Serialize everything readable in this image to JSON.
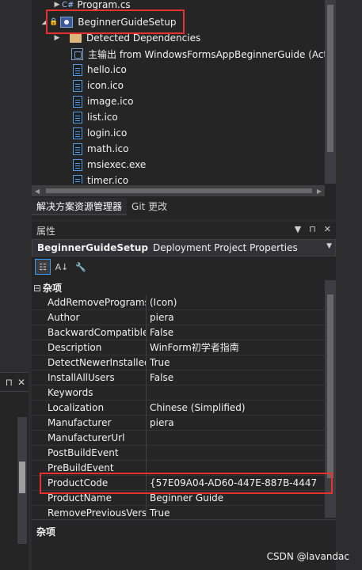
{
  "solution_explorer": {
    "partial_item": "Program.cs",
    "project": "BeginnerGuideSetup",
    "items": [
      {
        "label": "Detected Dependencies",
        "icon": "folder-icon"
      },
      {
        "label": "主输出 from WindowsFormsAppBeginnerGuide (Act",
        "icon": "primary-output-icon"
      },
      {
        "label": "hello.ico",
        "icon": "file-icon"
      },
      {
        "label": "icon.ico",
        "icon": "file-icon"
      },
      {
        "label": "image.ico",
        "icon": "file-icon"
      },
      {
        "label": "list.ico",
        "icon": "file-icon"
      },
      {
        "label": "login.ico",
        "icon": "file-icon"
      },
      {
        "label": "math.ico",
        "icon": "file-icon"
      },
      {
        "label": "msiexec.exe",
        "icon": "file-icon"
      },
      {
        "label": "timer.ico",
        "icon": "file-icon"
      }
    ],
    "tabs": [
      "解决方案资源管理器",
      "Git 更改"
    ]
  },
  "properties": {
    "title": "属性",
    "object_name": "BeginnerGuideSetup",
    "object_type": "Deployment Project Properties",
    "category": "杂项",
    "rows": [
      {
        "name": "AddRemoveProgramsIcon",
        "value": "(Icon)"
      },
      {
        "name": "Author",
        "value": "piera"
      },
      {
        "name": "BackwardCompatibleIDG",
        "value": "False"
      },
      {
        "name": "Description",
        "value": "WinForm初学者指南"
      },
      {
        "name": "DetectNewerInstalledVer",
        "value": "True"
      },
      {
        "name": "InstallAllUsers",
        "value": "False"
      },
      {
        "name": "Keywords",
        "value": ""
      },
      {
        "name": "Localization",
        "value": "Chinese (Simplified)"
      },
      {
        "name": "Manufacturer",
        "value": "piera"
      },
      {
        "name": "ManufacturerUrl",
        "value": ""
      },
      {
        "name": "PostBuildEvent",
        "value": ""
      },
      {
        "name": "PreBuildEvent",
        "value": ""
      },
      {
        "name": "ProductCode",
        "value": "{57E09A04-AD60-447E-887B-4447"
      },
      {
        "name": "ProductName",
        "value": "Beginner Guide"
      },
      {
        "name": "RemovePreviousVersions",
        "value": "True"
      }
    ],
    "description_title": "杂项"
  },
  "watermark": "CSDN @lavandac",
  "colors": {
    "highlight_box": "#e8302e",
    "background": "#252526"
  }
}
